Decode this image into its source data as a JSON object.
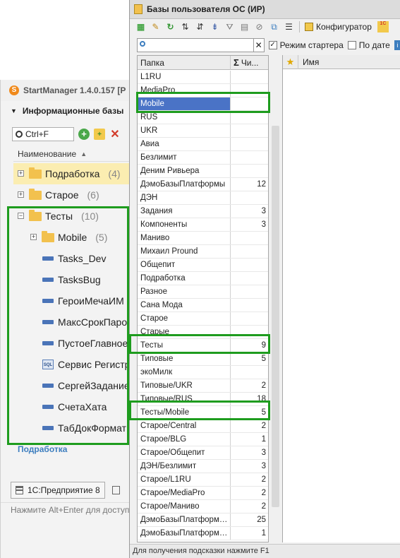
{
  "startmanager": {
    "title": "StartManager 1.4.0.157 [P",
    "logo_glyph": "S",
    "section_title": "Информационные базы",
    "search_value": "Ctrl+F",
    "column_header": "Наименование",
    "tree": [
      {
        "label": "Подработка",
        "count": "(4)"
      },
      {
        "label": "Старое",
        "count": "(6)"
      },
      {
        "label": "Тесты",
        "count": "(10)"
      },
      {
        "label": "Mobile",
        "count": "(5)"
      },
      {
        "label": "Tasks_Dev"
      },
      {
        "label": "TasksBug"
      },
      {
        "label": "ГероиМечаИМ"
      },
      {
        "label": "МаксСрокПаро"
      },
      {
        "label": "ПустоеГлавное"
      },
      {
        "label": "Сервис Регистр"
      },
      {
        "label": "СергейЗаданиe"
      },
      {
        "label": "СчетаХата"
      },
      {
        "label": "ТабДокФормат"
      }
    ],
    "sql_badge": "SQL",
    "current_group": "Подработка",
    "tab1_label": "1С:Предприятие 8",
    "tab2_label": "",
    "hint": "Нажмите Alt+Enter для доступа"
  },
  "window": {
    "title": "Базы пользователя ОС (ИР)",
    "toolbar": {
      "configurator_label": "Конфигуратор",
      "extra_badge": "1С"
    },
    "filter": {
      "value": "",
      "clear_glyph": "✕",
      "starter_mode_label": "Режим стартера",
      "starter_mode_checked": true,
      "by_date_label": "По дате"
    },
    "grid": {
      "col_folder": "Папка",
      "col_count": "Чи...",
      "rows": [
        {
          "folder": "L1RU",
          "count": ""
        },
        {
          "folder": "MediaPro",
          "count": ""
        },
        {
          "folder": "Mobile",
          "count": "",
          "selected": true
        },
        {
          "folder": "RUS",
          "count": ""
        },
        {
          "folder": "UKR",
          "count": ""
        },
        {
          "folder": "Авиа",
          "count": ""
        },
        {
          "folder": "Безлимит",
          "count": ""
        },
        {
          "folder": "Деним Ривьера",
          "count": ""
        },
        {
          "folder": "ДэмоБазыПлатформы",
          "count": "12"
        },
        {
          "folder": "ДЭН",
          "count": ""
        },
        {
          "folder": "Задания",
          "count": "3"
        },
        {
          "folder": "Компоненты",
          "count": "3"
        },
        {
          "folder": "Маниво",
          "count": ""
        },
        {
          "folder": "Михаил Pround",
          "count": ""
        },
        {
          "folder": "Общепит",
          "count": ""
        },
        {
          "folder": "Подработка",
          "count": ""
        },
        {
          "folder": "Разное",
          "count": ""
        },
        {
          "folder": "Сана Мода",
          "count": ""
        },
        {
          "folder": "Старое",
          "count": ""
        },
        {
          "folder": "Старые",
          "count": ""
        },
        {
          "folder": "Тесты",
          "count": "9"
        },
        {
          "folder": "Типовые",
          "count": "5"
        },
        {
          "folder": "экоМилк",
          "count": ""
        },
        {
          "folder": "Типовые/UKR",
          "count": "2"
        },
        {
          "folder": "Типовые/RUS",
          "count": "18"
        },
        {
          "folder": "Тесты/Mobile",
          "count": "5"
        },
        {
          "folder": "Старое/Central",
          "count": "2"
        },
        {
          "folder": "Старое/BLG",
          "count": "1"
        },
        {
          "folder": "Старое/Общепит",
          "count": "3"
        },
        {
          "folder": "ДЭН/Безлимит",
          "count": "3"
        },
        {
          "folder": "Старое/L1RU",
          "count": "2"
        },
        {
          "folder": "Старое/MediaPro",
          "count": "2"
        },
        {
          "folder": "Старое/Маниво",
          "count": "2"
        },
        {
          "folder": "ДэмоБазыПлатформы...",
          "count": "25"
        },
        {
          "folder": "ДэмоБазыПлатформы...",
          "count": "1"
        }
      ]
    },
    "right_pane": {
      "col_name": "Имя"
    },
    "status": "Для получения подсказки нажмите F1"
  },
  "colors": {
    "highlight": "#1e9c1e",
    "selection": "#4a73c6",
    "tree_selection": "#fbedb1",
    "folder": "#f2c14e"
  }
}
